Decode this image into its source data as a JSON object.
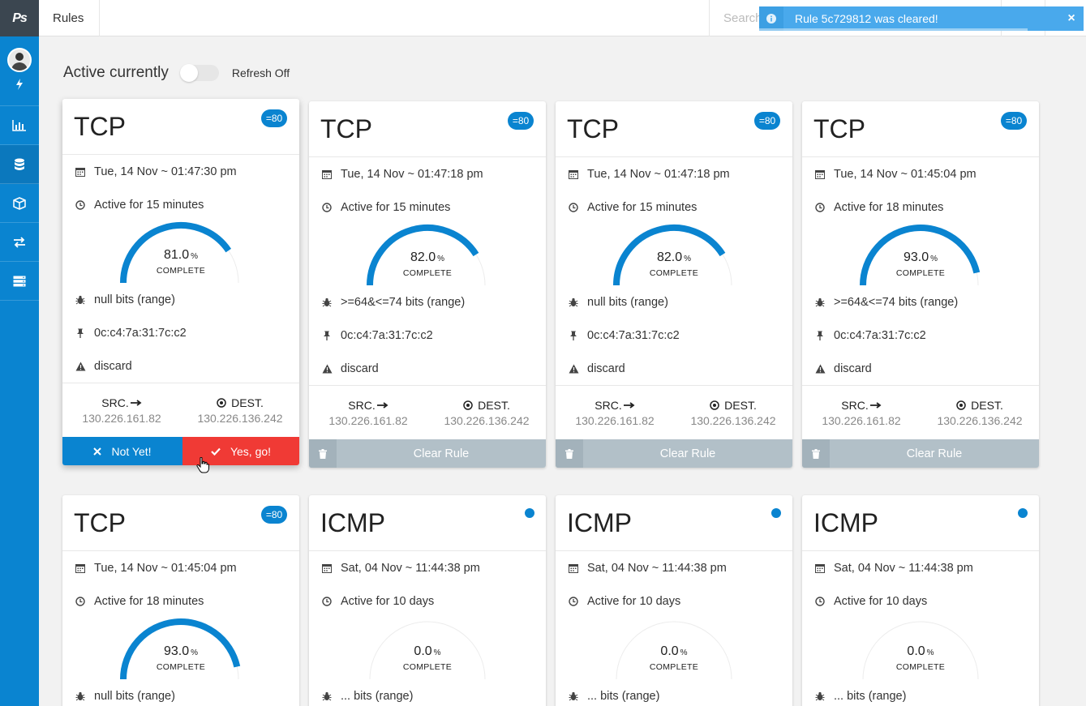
{
  "app": {
    "logo": "Ps",
    "page_title": "Rules"
  },
  "search": {
    "placeholder": "Search"
  },
  "toast": {
    "message": "Rule 5c729812 was cleared!",
    "close": "×"
  },
  "header": {
    "active_label": "Active currently",
    "refresh_label": "Refresh Off"
  },
  "labels": {
    "complete": "COMPLETE",
    "percent_sign": "%",
    "src": "SRC.",
    "dest": "DEST.",
    "not_yet": "Not Yet!",
    "yes_go": "Yes, go!",
    "clear_rule": "Clear Rule"
  },
  "sidebar": {
    "items": [
      "bolt-icon",
      "chart-icon",
      "database-icon",
      "box-icon",
      "exchange-icon",
      "server-icon"
    ]
  },
  "colors": {
    "primary": "#0a84d0",
    "danger": "#f03a35",
    "clear": "#b2c0c8"
  },
  "cards": [
    {
      "protocol": "TCP",
      "badge": "=80",
      "date": "Tue, 14 Nov ~ 01:47:30 pm",
      "active": "Active for 15 minutes",
      "percent": "81.0",
      "bits": "null bits (range)",
      "mac": "0c:c4:7a:31:7c:c2",
      "action": "discard",
      "src": "130.226.161.82",
      "dest": "130.226.136.242"
    },
    {
      "protocol": "TCP",
      "badge": "=80",
      "date": "Tue, 14 Nov ~ 01:47:18 pm",
      "active": "Active for 15 minutes",
      "percent": "82.0",
      "bits": ">=64&<=74 bits (range)",
      "mac": "0c:c4:7a:31:7c:c2",
      "action": "discard",
      "src": "130.226.161.82",
      "dest": "130.226.136.242"
    },
    {
      "protocol": "TCP",
      "badge": "=80",
      "date": "Tue, 14 Nov ~ 01:47:18 pm",
      "active": "Active for 15 minutes",
      "percent": "82.0",
      "bits": "null bits (range)",
      "mac": "0c:c4:7a:31:7c:c2",
      "action": "discard",
      "src": "130.226.161.82",
      "dest": "130.226.136.242"
    },
    {
      "protocol": "TCP",
      "badge": "=80",
      "date": "Tue, 14 Nov ~ 01:45:04 pm",
      "active": "Active for 18 minutes",
      "percent": "93.0",
      "bits": ">=64&<=74 bits (range)",
      "mac": "0c:c4:7a:31:7c:c2",
      "action": "discard",
      "src": "130.226.161.82",
      "dest": "130.226.136.242"
    },
    {
      "protocol": "TCP",
      "badge": "=80",
      "date": "Tue, 14 Nov ~ 01:45:04 pm",
      "active": "Active for 18 minutes",
      "percent": "93.0",
      "bits": "null bits (range)"
    },
    {
      "protocol": "ICMP",
      "date": "Sat, 04 Nov ~ 11:44:38 pm",
      "active": "Active for 10 days",
      "percent": "0.0",
      "bits": "... bits (range)"
    },
    {
      "protocol": "ICMP",
      "date": "Sat, 04 Nov ~ 11:44:38 pm",
      "active": "Active for 10 days",
      "percent": "0.0",
      "bits": "... bits (range)"
    },
    {
      "protocol": "ICMP",
      "date": "Sat, 04 Nov ~ 11:44:38 pm",
      "active": "Active for 10 days",
      "percent": "0.0",
      "bits": "... bits (range)"
    }
  ]
}
